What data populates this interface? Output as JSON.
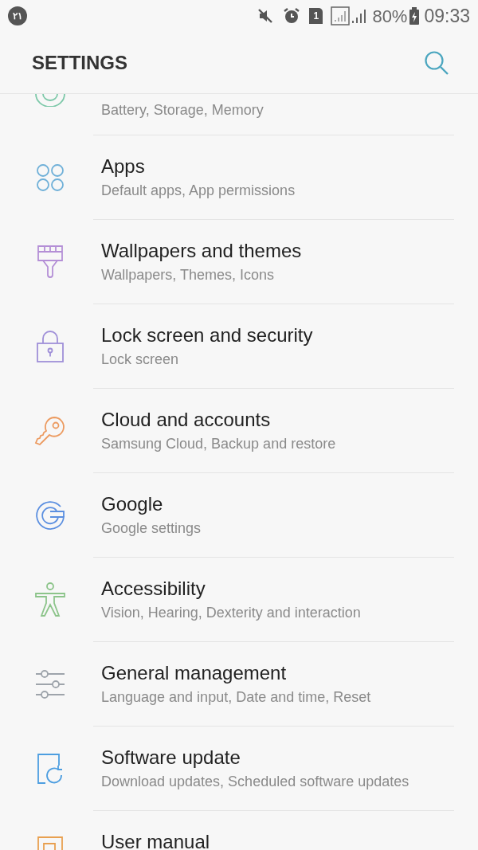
{
  "status_bar": {
    "notification_count": "۲۱",
    "sim_slot": "1",
    "battery": "80%",
    "time": "09:33"
  },
  "header": {
    "title": "SETTINGS"
  },
  "items": [
    {
      "kind": "device",
      "color": "#7cc8a8",
      "subtitle": "Battery, Storage, Memory"
    },
    {
      "kind": "apps",
      "color": "#6fb0d8",
      "title": "Apps",
      "subtitle": "Default apps, App permissions"
    },
    {
      "kind": "brush",
      "color": "#b48fd6",
      "title": "Wallpapers and themes",
      "subtitle": "Wallpapers, Themes, Icons"
    },
    {
      "kind": "lock",
      "color": "#9f8fd8",
      "title": "Lock screen and security",
      "subtitle": "Lock screen"
    },
    {
      "kind": "key",
      "color": "#ec9a5f",
      "title": "Cloud and accounts",
      "subtitle": "Samsung Cloud, Backup and restore"
    },
    {
      "kind": "google",
      "color": "#5b8fe0",
      "title": "Google",
      "subtitle": "Google settings"
    },
    {
      "kind": "person",
      "color": "#8cc48a",
      "title": "Accessibility",
      "subtitle": "Vision, Hearing, Dexterity and interaction"
    },
    {
      "kind": "sliders",
      "color": "#9ea4ab",
      "title": "General management",
      "subtitle": "Language and input, Date and time, Reset"
    },
    {
      "kind": "update",
      "color": "#4d9ee0",
      "title": "Software update",
      "subtitle": "Download updates, Scheduled software updates"
    },
    {
      "kind": "manual",
      "color": "#e8a050",
      "title": "User manual"
    }
  ]
}
